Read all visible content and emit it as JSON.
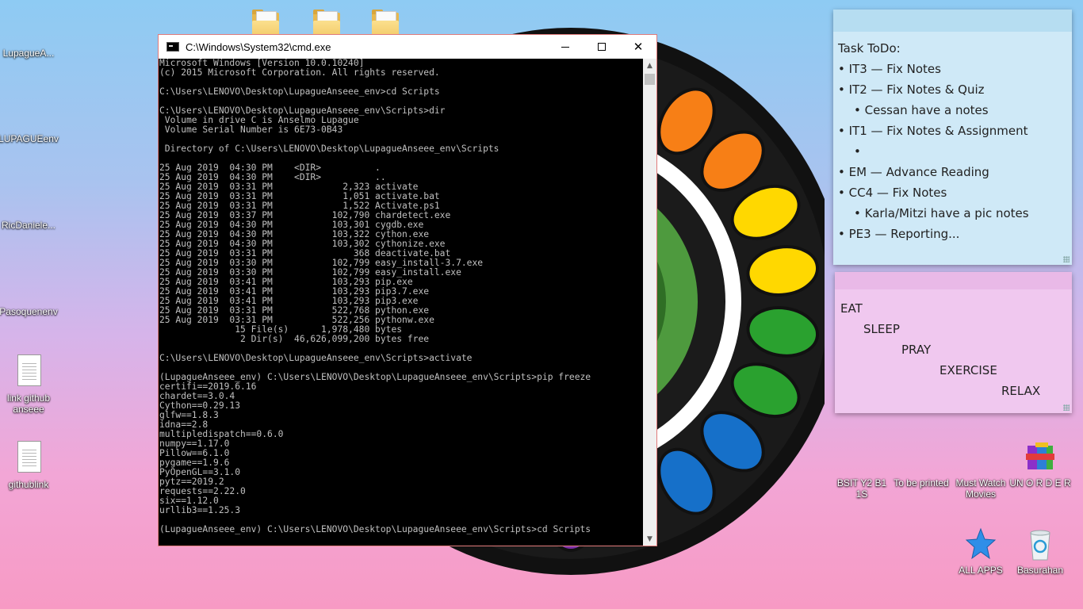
{
  "desktop": {
    "left_icons": [
      {
        "label": "LupagueA...",
        "kind": "folder"
      },
      {
        "label": "LUPAGUEenv",
        "kind": "folder"
      },
      {
        "label": "RicDaniele...",
        "kind": "folder"
      },
      {
        "label": "Pasoquenenv",
        "kind": "folder"
      },
      {
        "label": "link github anseee",
        "kind": "document"
      },
      {
        "label": "githublink",
        "kind": "document"
      }
    ],
    "right_icons": [
      {
        "label": "BSIT Y2 B1 1S",
        "kind": "folder"
      },
      {
        "label": "To be printed",
        "kind": "folder"
      },
      {
        "label": "Must Watch Movies",
        "kind": "folder"
      },
      {
        "label": "UN O R D E R",
        "kind": "winrar"
      },
      {
        "label": "ALL APPS",
        "kind": "star"
      },
      {
        "label": "Basurahan",
        "kind": "recycle-bin"
      }
    ],
    "wallpaper_colors": [
      "#e8231c",
      "#f77f16",
      "#ffd800",
      "#2aa12f",
      "#1670c9",
      "#7b2fa8"
    ]
  },
  "cmd_window": {
    "title": "C:\\Windows\\System32\\cmd.exe",
    "controls": {
      "minimize": "—",
      "maximize": "☐",
      "close": "✕"
    },
    "lines": [
      "Microsoft Windows [Version 10.0.10240]",
      "(c) 2015 Microsoft Corporation. All rights reserved.",
      "",
      "C:\\Users\\LENOVO\\Desktop\\LupagueAnseee_env>cd Scripts",
      "",
      "C:\\Users\\LENOVO\\Desktop\\LupagueAnseee_env\\Scripts>dir",
      " Volume in drive C is Anselmo Lupague",
      " Volume Serial Number is 6E73-0B43",
      "",
      " Directory of C:\\Users\\LENOVO\\Desktop\\LupagueAnseee_env\\Scripts",
      "",
      "25 Aug 2019  04:30 PM    <DIR>          .",
      "25 Aug 2019  04:30 PM    <DIR>          ..",
      "25 Aug 2019  03:31 PM             2,323 activate",
      "25 Aug 2019  03:31 PM             1,051 activate.bat",
      "25 Aug 2019  03:31 PM             1,522 Activate.ps1",
      "25 Aug 2019  03:37 PM           102,790 chardetect.exe",
      "25 Aug 2019  04:30 PM           103,301 cygdb.exe",
      "25 Aug 2019  04:30 PM           103,322 cython.exe",
      "25 Aug 2019  04:30 PM           103,302 cythonize.exe",
      "25 Aug 2019  03:31 PM               368 deactivate.bat",
      "25 Aug 2019  03:30 PM           102,799 easy_install-3.7.exe",
      "25 Aug 2019  03:30 PM           102,799 easy_install.exe",
      "25 Aug 2019  03:41 PM           103,293 pip.exe",
      "25 Aug 2019  03:41 PM           103,293 pip3.7.exe",
      "25 Aug 2019  03:41 PM           103,293 pip3.exe",
      "25 Aug 2019  03:31 PM           522,768 python.exe",
      "25 Aug 2019  03:31 PM           522,256 pythonw.exe",
      "              15 File(s)      1,978,480 bytes",
      "               2 Dir(s)  46,626,099,200 bytes free",
      "",
      "C:\\Users\\LENOVO\\Desktop\\LupagueAnseee_env\\Scripts>activate",
      "",
      "(LupagueAnseee_env) C:\\Users\\LENOVO\\Desktop\\LupagueAnseee_env\\Scripts>pip freeze",
      "certifi==2019.6.16",
      "chardet==3.0.4",
      "Cython==0.29.13",
      "glfw==1.8.3",
      "idna==2.8",
      "multipledispatch==0.6.0",
      "numpy==1.17.0",
      "Pillow==6.1.0",
      "pygame==1.9.6",
      "PyOpenGL==3.1.0",
      "pytz==2019.2",
      "requests==2.22.0",
      "six==1.12.0",
      "urllib3==1.25.3",
      "",
      "(LupagueAnseee_env) C:\\Users\\LENOVO\\Desktop\\LupagueAnseee_env\\Scripts>cd Scripts"
    ]
  },
  "sticky_todo": {
    "heading": "Task ToDo:",
    "items": [
      {
        "text": "• IT3 — Fix Notes",
        "sub": false
      },
      {
        "text": "• IT2 — Fix Notes & Quiz",
        "sub": false
      },
      {
        "text": "• Cessan have a notes",
        "sub": true
      },
      {
        "text": "• IT1 — Fix Notes & Assignment",
        "sub": false
      },
      {
        "text": "•",
        "sub": true
      },
      {
        "text": "• EM — Advance Reading",
        "sub": false
      },
      {
        "text": "• CC4 — Fix Notes",
        "sub": false
      },
      {
        "text": "• Karla/Mitzi have a pic notes",
        "sub": true
      },
      {
        "text": "• PE3 — Reporting...",
        "sub": false
      }
    ]
  },
  "sticky_motto": {
    "words": [
      "EAT",
      "SLEEP",
      "PRAY",
      "EXERCISE",
      "RELAX"
    ]
  }
}
